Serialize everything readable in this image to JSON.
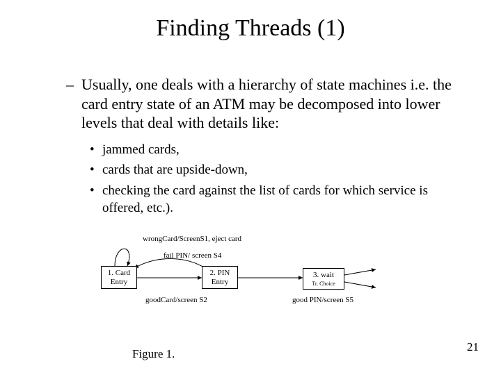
{
  "title": "Finding Threads (1)",
  "bullet1": "Usually, one deals with a hierarchy of state machines i.e. the card entry state of an ATM may be decomposed into lower levels that deal with details like:",
  "sub": {
    "a": "jammed cards,",
    "b": "cards that are upside-down,",
    "c": "checking the card against the list of cards for which service is offered, etc.)."
  },
  "diagram": {
    "state1": {
      "l1": "1. Card",
      "l2": "Entry"
    },
    "state2": {
      "l1": "2. PIN",
      "l2": "Entry"
    },
    "state3": {
      "l1": "3. wait",
      "sub": "Tr. Choice"
    },
    "wrongCard": "wrongCard/ScreenS1, eject card",
    "failPin": "fail PIN/ screen S4",
    "goodCard": "goodCard/screen S2",
    "goodPin": "good PIN/screen S5"
  },
  "figure_caption": "Figure 1.",
  "page_number": "21"
}
